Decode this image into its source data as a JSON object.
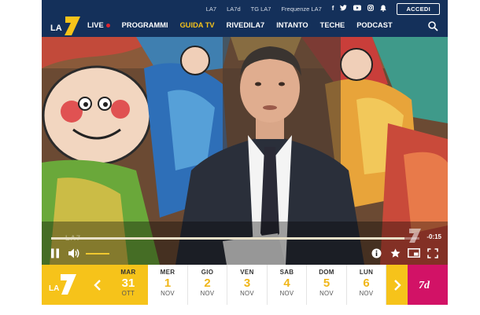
{
  "header": {
    "top_links": [
      "LA7",
      "LA7d",
      "TG LA7",
      "Frequenze LA7"
    ],
    "social_icons": [
      "facebook-icon",
      "twitter-icon",
      "youtube-icon",
      "instagram-icon",
      "bell-icon"
    ],
    "login_label": "ACCEDI",
    "logo_text": "LA",
    "logo_number": "7",
    "nav": [
      {
        "label": "LIVE",
        "live": true
      },
      {
        "label": "PROGRAMMI"
      },
      {
        "label": "GUIDA TV",
        "active": true
      },
      {
        "label": "RIVEDILA7"
      },
      {
        "label": "INTANTO"
      },
      {
        "label": "TECHE"
      },
      {
        "label": "PODCAST"
      }
    ]
  },
  "player": {
    "time_remaining": "-0:15",
    "progress": 0.96,
    "volume": 0.85,
    "watermark": "LA7"
  },
  "schedule": {
    "logo_text": "LA",
    "logo_number": "7",
    "prev_label": "<",
    "next_label": ">",
    "days": [
      {
        "name": "MAR",
        "num": "31",
        "month": "OTT",
        "today": true
      },
      {
        "name": "MER",
        "num": "1",
        "month": "NOV"
      },
      {
        "name": "GIO",
        "num": "2",
        "month": "NOV"
      },
      {
        "name": "VEN",
        "num": "3",
        "month": "NOV"
      },
      {
        "name": "SAB",
        "num": "4",
        "month": "NOV"
      },
      {
        "name": "DOM",
        "num": "5",
        "month": "NOV"
      },
      {
        "name": "LUN",
        "num": "6",
        "month": "NOV"
      }
    ],
    "la7d_logo_text": "7d"
  },
  "colors": {
    "header_bg": "#14305a",
    "accent_yellow": "#f6c31a",
    "live_red": "#e0232f",
    "la7d_pink": "#d21266"
  }
}
